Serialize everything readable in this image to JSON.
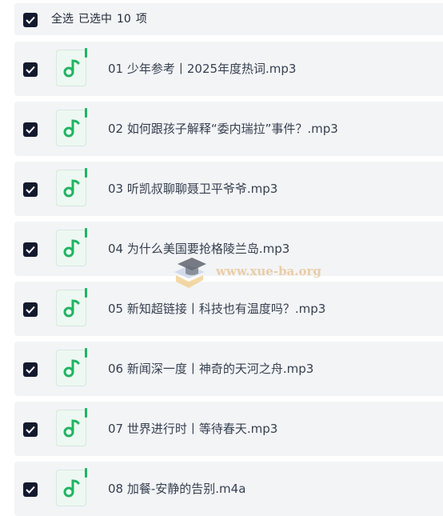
{
  "header": {
    "select_all": "全选",
    "selected_prefix": "已选中",
    "selected_count": "10",
    "selected_suffix": "项"
  },
  "accent_color": "#22b364",
  "checkbox_color": "#141a2e",
  "file_icon": "music-note-icon",
  "files": [
    {
      "name": "01 少年参考丨2025年度热词.mp3",
      "checked": true
    },
    {
      "name": "02 如何跟孩子解释“委内瑞拉”事件？.mp3",
      "checked": true
    },
    {
      "name": "03 听凯叔聊聊聂卫平爷爷.mp3",
      "checked": true
    },
    {
      "name": "04 为什么美国要抢格陵兰岛.mp3",
      "checked": true
    },
    {
      "name": "05 新知超链接丨科技也有温度吗？.mp3",
      "checked": true
    },
    {
      "name": "06 新闻深一度丨神奇的天河之舟.mp3",
      "checked": true
    },
    {
      "name": "07 世界进行时丨等待春天.mp3",
      "checked": true
    },
    {
      "name": "08 加餐-安静的告别.m4a",
      "checked": true
    }
  ],
  "watermark": {
    "text": "www.xue-ba.org"
  }
}
